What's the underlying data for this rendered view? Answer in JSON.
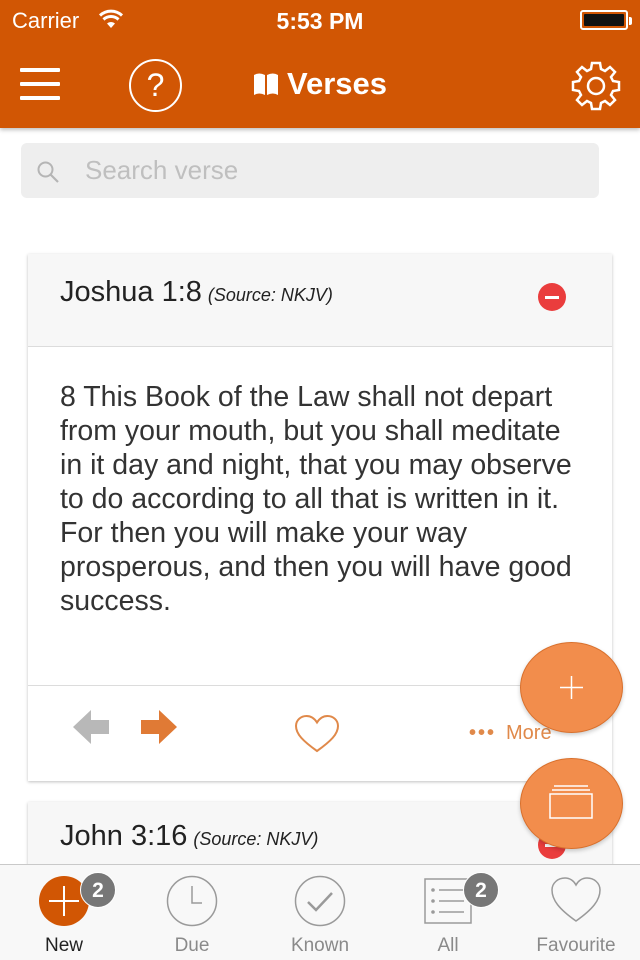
{
  "status_bar": {
    "carrier": "Carrier",
    "time": "5:53 PM"
  },
  "header": {
    "title": "Verses",
    "help_glyph": "?",
    "icons": [
      "menu-icon",
      "help-icon",
      "book-icon",
      "gear-icon"
    ]
  },
  "search": {
    "placeholder": "Search verse",
    "value": ""
  },
  "verses": [
    {
      "reference": "Joshua 1:8",
      "source": "(Source: NKJV)",
      "text": "8 This Book of the Law shall not depart from your mouth, but you shall meditate in it day and night, that you may observe to do according to all that is written in it. For then you will make your way prosperous, and then you will have good success.",
      "more_label": "More"
    },
    {
      "reference": "John 3:16",
      "source": "(Source: NKJV)"
    }
  ],
  "tabs": [
    {
      "label": "New",
      "badge": "2"
    },
    {
      "label": "Due"
    },
    {
      "label": "Known"
    },
    {
      "label": "All",
      "badge": "2"
    },
    {
      "label": "Favourite"
    }
  ],
  "colors": {
    "brand": "#d15604",
    "fab": "#f28d4c",
    "delete": "#ea3d3d",
    "arrow_active": "#e07a35",
    "arrow_inactive": "#b8b8b8"
  }
}
